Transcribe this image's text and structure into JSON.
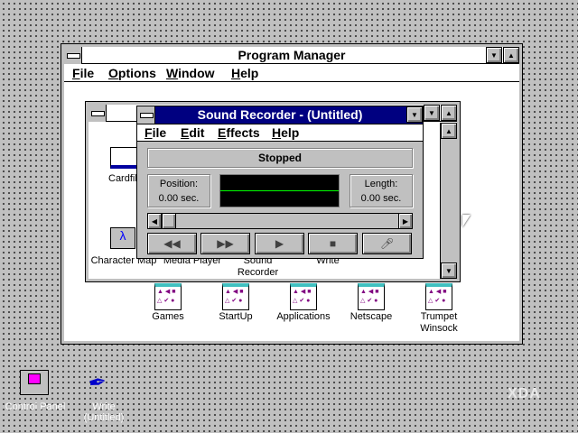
{
  "program_manager": {
    "title": "Program Manager",
    "menu": [
      "File",
      "Options",
      "Window",
      "Help"
    ]
  },
  "accessories": {
    "icons": [
      "Cardfile",
      "Character Map",
      "Media Player",
      "Sound Recorder",
      "Write"
    ]
  },
  "sound_recorder": {
    "title": "Sound Recorder - (Untitled)",
    "menu": [
      "File",
      "Edit",
      "Effects",
      "Help"
    ],
    "status": "Stopped",
    "position_label": "Position:",
    "position_value": "0.00 sec.",
    "length_label": "Length:",
    "length_value": "0.00 sec.",
    "wave_color": "#00ff00",
    "progress": 0
  },
  "groups": [
    "Games",
    "StartUp",
    "Applications",
    "Netscape",
    "Trumpet Winsock"
  ],
  "desktop_icons": [
    {
      "label": "Control Panel"
    },
    {
      "label": "Write",
      "sublabel": "(Untitled)"
    }
  ],
  "watermark": "XDA",
  "colors": {
    "title_active": "#000080",
    "desktop": "#c0c0c0"
  }
}
